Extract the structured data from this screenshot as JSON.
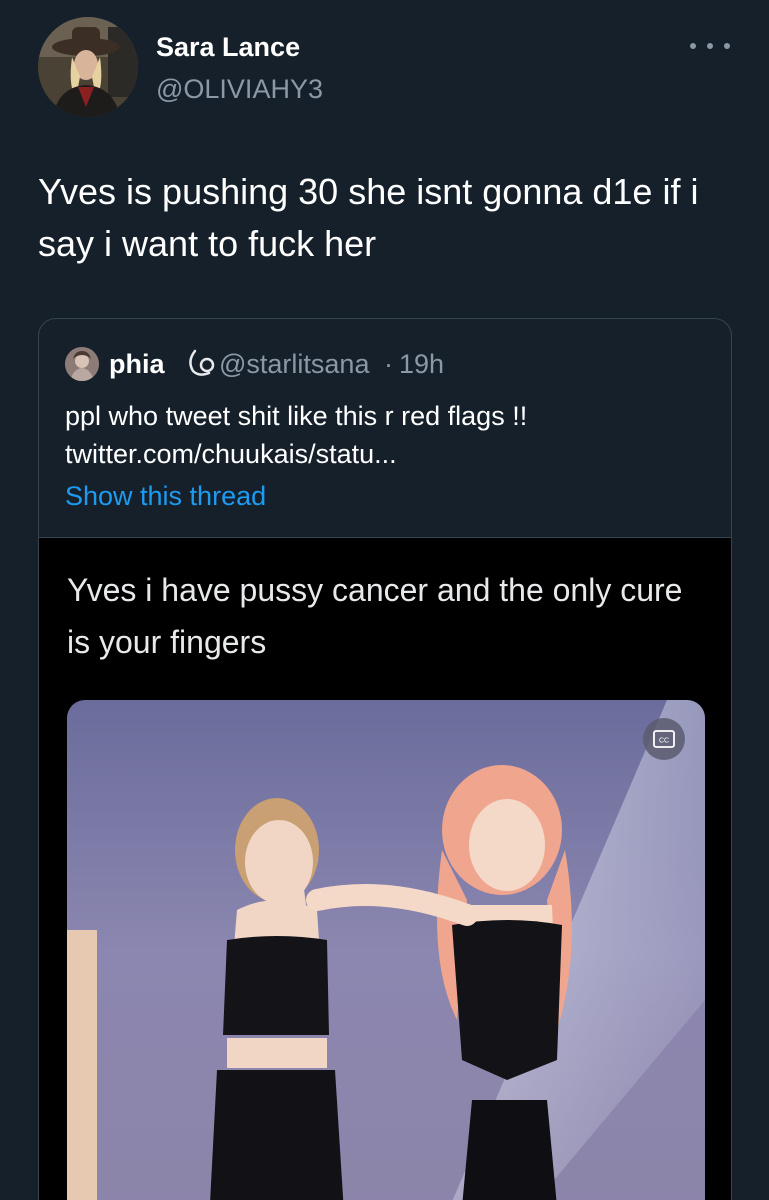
{
  "author": {
    "name": "Sara Lance",
    "handle": "@OLIVIAHY3"
  },
  "tweet": {
    "text": "Yves is pushing 30 she isnt gonna d1e if i say i want to fuck her"
  },
  "quoted": {
    "name": "phia",
    "handle": "@starlitsana",
    "separator": "·",
    "time": "19h",
    "text": "ppl who tweet shit like this r red flags !! twitter.com/chuukais/statu...",
    "show_thread": "Show this thread",
    "media_caption": "Yves i have pussy cancer and the only cure is your fingers"
  },
  "colors": {
    "background": "#15202b",
    "secondary_text": "#8b98a5",
    "link": "#1d9bf0",
    "border": "#38444d"
  },
  "icons": {
    "more": "more-horizontal-icon",
    "cc": "closed-captions-icon",
    "name_emoji": "moon-emoji-icon"
  }
}
